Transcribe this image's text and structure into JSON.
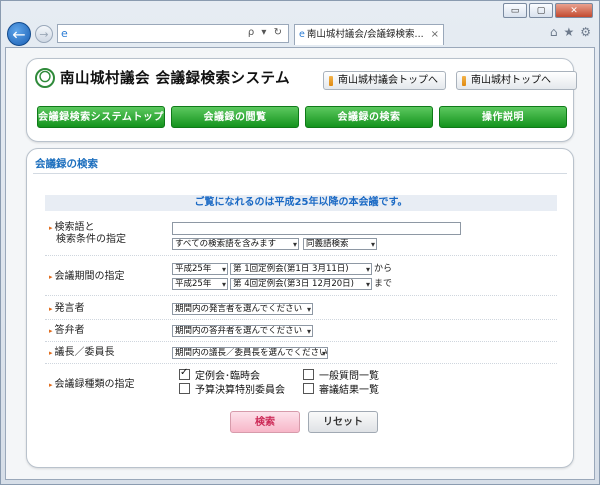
{
  "browser": {
    "tab_title": "南山城村議会/会議録検索...",
    "tab_close": "×",
    "addr_tools": "ρ ▾ ↻",
    "window_buttons": [
      "▭",
      "▢",
      "✕"
    ],
    "icons": [
      "home-icon",
      "star-icon",
      "gear-icon"
    ]
  },
  "header": {
    "logo_mark": "〇",
    "logo_text": "南山城村議会 会議録検索システム",
    "top_links": [
      "南山城村議会トップへ",
      "南山城村トップへ"
    ],
    "nav": [
      "会議録検索システムトップ",
      "会議録の閲覧",
      "会議録の検索",
      "操作説明"
    ]
  },
  "search": {
    "section_title": "会議録の検索",
    "notice": "ご覧になれるのは平成25年以降の本会議です。",
    "keyword": {
      "label_line1": "検索語と",
      "label_line2": "検索条件の指定",
      "value": "",
      "condition": "すべての検索語を含みます",
      "synonym": "同義語検索"
    },
    "period": {
      "label": "会議期間の指定",
      "from_era": "平成25年",
      "from_meeting": "第 1回定例会(第1日  3月11日)",
      "from_suffix": "から",
      "to_era": "平成25年",
      "to_meeting": "第 4回定例会(第3日 12月20日)",
      "to_suffix": "まで"
    },
    "speaker": {
      "label": "発言者",
      "value": "期間内の発言者を選んでください"
    },
    "answerer": {
      "label": "答弁者",
      "value": "期間内の答弁者を選んでください"
    },
    "chair": {
      "label": "議長／委員長",
      "value": "期間内の議長／委員長を選んでください"
    },
    "types": {
      "label": "会議録種類の指定",
      "options": [
        {
          "label": "定例会･臨時会",
          "checked": true
        },
        {
          "label": "一般質問一覧",
          "checked": false
        },
        {
          "label": "予算決算特別委員会",
          "checked": false
        },
        {
          "label": "審議結果一覧",
          "checked": false
        }
      ]
    },
    "search_button": "検索",
    "reset_button": "リセット"
  },
  "colors": {
    "nav_green": "#14931d",
    "section_blue": "#1d6fbe",
    "search_pink": "#f7b6c8"
  }
}
